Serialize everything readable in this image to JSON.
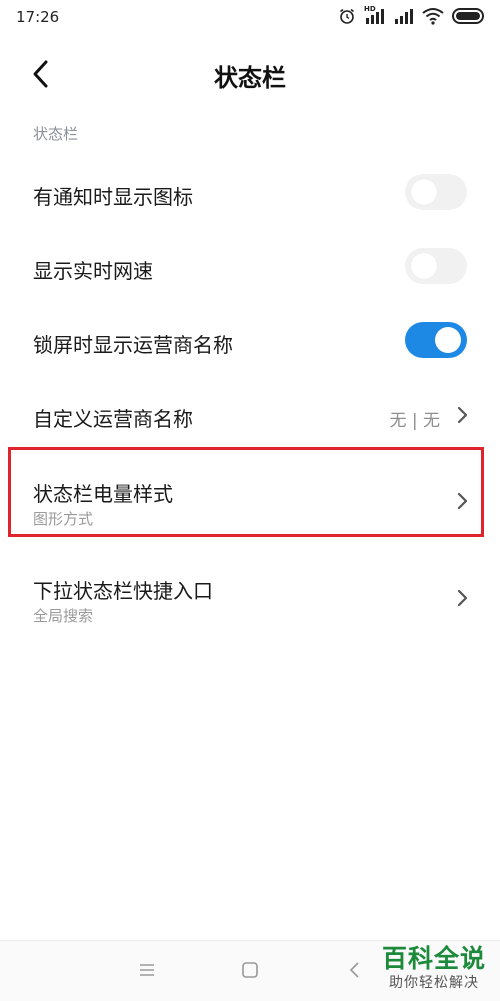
{
  "status_bar": {
    "time": "17:26",
    "hd_label": "HD"
  },
  "header": {
    "title": "状态栏"
  },
  "section": {
    "label": "状态栏"
  },
  "rows": [
    {
      "label": "有通知时显示图标",
      "type": "toggle",
      "state": "off"
    },
    {
      "label": "显示实时网速",
      "type": "toggle",
      "state": "off"
    },
    {
      "label": "锁屏时显示运营商名称",
      "type": "toggle",
      "state": "on"
    },
    {
      "label": "自定义运营商名称",
      "type": "link",
      "value": "无 | 无"
    },
    {
      "label": "状态栏电量样式",
      "type": "link",
      "sub": "图形方式",
      "highlighted": true
    },
    {
      "label": "下拉状态栏快捷入口",
      "type": "link",
      "sub": "全局搜索"
    }
  ],
  "colors": {
    "accent": "#1e88e5",
    "highlight_border": "#e0242b",
    "watermark_green": "#1c8a3a"
  },
  "watermark": {
    "title": "百科全说",
    "subtitle": "助你轻松解决"
  },
  "nav": {
    "icons": [
      "menu-icon",
      "home-icon",
      "back-icon"
    ]
  }
}
